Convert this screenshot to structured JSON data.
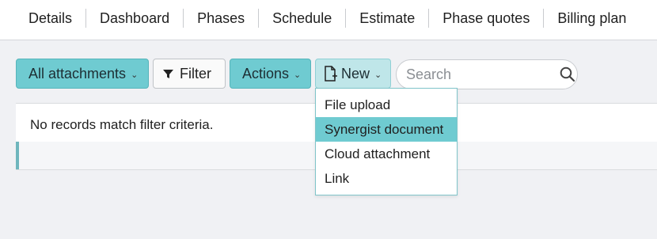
{
  "tabs": [
    {
      "label": "Details"
    },
    {
      "label": "Dashboard"
    },
    {
      "label": "Phases"
    },
    {
      "label": "Schedule"
    },
    {
      "label": "Estimate"
    },
    {
      "label": "Phase quotes"
    },
    {
      "label": "Billing plan"
    }
  ],
  "toolbar": {
    "all_attachments_label": "All attachments",
    "filter_label": "Filter",
    "actions_label": "Actions",
    "new_label": "New"
  },
  "search": {
    "placeholder": "Search",
    "value": ""
  },
  "panel": {
    "empty_message": "No records match filter criteria."
  },
  "new_menu": {
    "items": [
      {
        "label": "File upload"
      },
      {
        "label": "Synergist document"
      },
      {
        "label": "Cloud attachment"
      },
      {
        "label": "Link"
      }
    ],
    "highlighted": "Synergist document"
  },
  "icons": {
    "filter": "funnel-icon",
    "new": "document-plus-icon",
    "search": "magnifier-icon",
    "chevron": "chevron-down-icon"
  },
  "colors": {
    "accent": "#6fcbd1",
    "accent_light": "#bfe6e9",
    "background": "#f0f1f4"
  }
}
